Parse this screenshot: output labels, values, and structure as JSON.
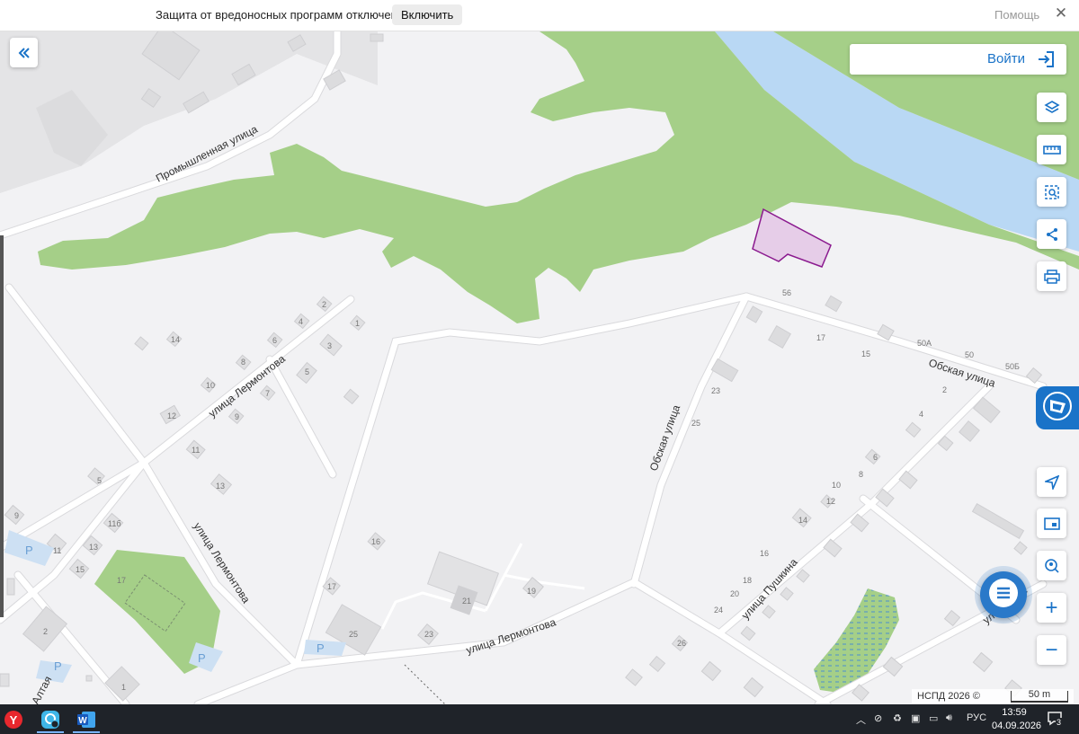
{
  "notification": {
    "message": "Защита от вредоносных программ отключена",
    "enable_label": "Включить",
    "help_label": "Помощь",
    "close_label": "✕"
  },
  "header": {
    "login_label": "Войти"
  },
  "map": {
    "streets": {
      "promyshlennaya": "Промышленная улица",
      "lermontova_upper": "улица Лермонтова",
      "lermontova_mid": "улица Лермонтова",
      "lermontova_bottom": "улица Лермонтова",
      "obskaya_vertical": "Обская улица",
      "obskaya_horizontal": "Обская улица",
      "pushkina": "улица Пушкина",
      "altaya": "Алтая",
      "partial_right": "ул… …ачё"
    },
    "house_numbers": [
      "2",
      "4",
      "1",
      "14",
      "6",
      "3",
      "8",
      "5",
      "10",
      "7",
      "12",
      "9",
      "11",
      "13",
      "5",
      "9",
      "11б",
      "11",
      "13",
      "15",
      "17",
      "2",
      "1",
      "16",
      "17",
      "25",
      "21",
      "19",
      "23",
      "26",
      "56",
      "17",
      "15",
      "50А",
      "50",
      "50Б",
      "23",
      "25",
      "2",
      "4",
      "6",
      "8",
      "10",
      "12",
      "14",
      "16",
      "18",
      "20",
      "24"
    ],
    "parking_label": "P",
    "colors": {
      "background": "#f2f2f4",
      "forest": "#a5cf88",
      "river": "#b9d8f4",
      "plot_fill": "#e6cde8",
      "plot_stroke": "#8b1a8f",
      "road": "#ffffff",
      "accent": "#1a73c8"
    }
  },
  "attribution": {
    "copyright": "НСПД 2026 ©",
    "scale": "50 m"
  },
  "controls": {
    "collapse_icon": "double-chevron-left-icon",
    "layers_icon": "layers-icon",
    "ruler_icon": "ruler-icon",
    "area_select_icon": "area-select-icon",
    "share_icon": "share-icon",
    "print_icon": "print-icon",
    "locate_icon": "navigation-arrow-icon",
    "screen_icon": "screen-icon",
    "geo_search_icon": "location-search-icon",
    "zoom_in_label": "+",
    "zoom_out_label": "−"
  },
  "taskbar": {
    "apps": [
      "Yandex Browser",
      "Messenger",
      "Microsoft Word"
    ],
    "word_letter": "W",
    "yandex_letter": "Y",
    "language": "РУС",
    "time": "13:59",
    "date": "04.09.2026",
    "notifications_count": "3"
  }
}
